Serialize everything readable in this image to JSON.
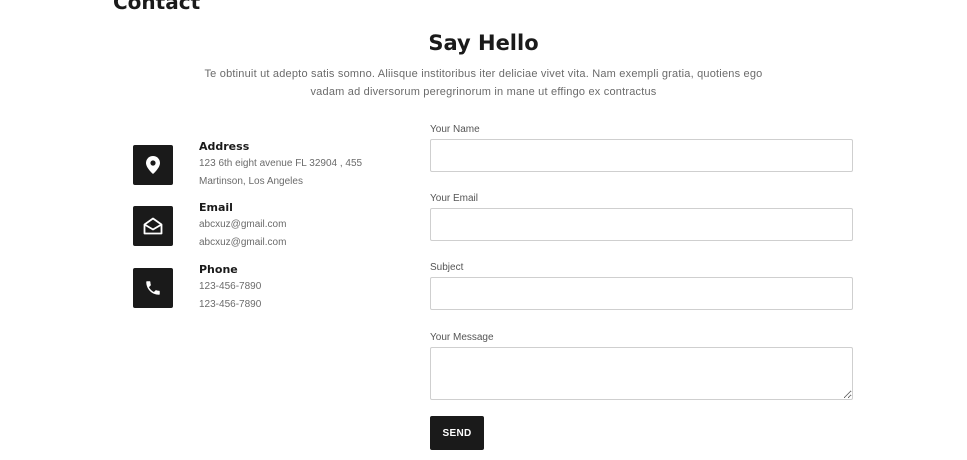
{
  "page": {
    "heading": "Contact"
  },
  "intro": {
    "title": "Say Hello",
    "subtitle_line1": "Te obtinuit ut adepto satis somno. Aliisque institoribus iter deliciae vivet vita. Nam exempli gratia, quotiens ego",
    "subtitle_line2": "vadam ad diversorum peregrinorum in mane ut effingo ex contractus"
  },
  "contact_info": {
    "address": {
      "title": "Address",
      "line1": "123 6th eight avenue FL 32904 , 455",
      "line2": "Martinson, Los Angeles",
      "icon": "map-pin-icon"
    },
    "email": {
      "title": "Email",
      "line1": "abcxuz@gmail.com",
      "line2": "abcxuz@gmail.com",
      "icon": "envelope-open-icon"
    },
    "phone": {
      "title": "Phone",
      "line1": "123-456-7890",
      "line2": "123-456-7890",
      "icon": "phone-icon"
    }
  },
  "form": {
    "name_label": "Your Name",
    "email_label": "Your Email",
    "subject_label": "Subject",
    "message_label": "Your Message",
    "name_value": "",
    "email_value": "",
    "subject_value": "",
    "message_value": "",
    "send_label": "SEND"
  }
}
